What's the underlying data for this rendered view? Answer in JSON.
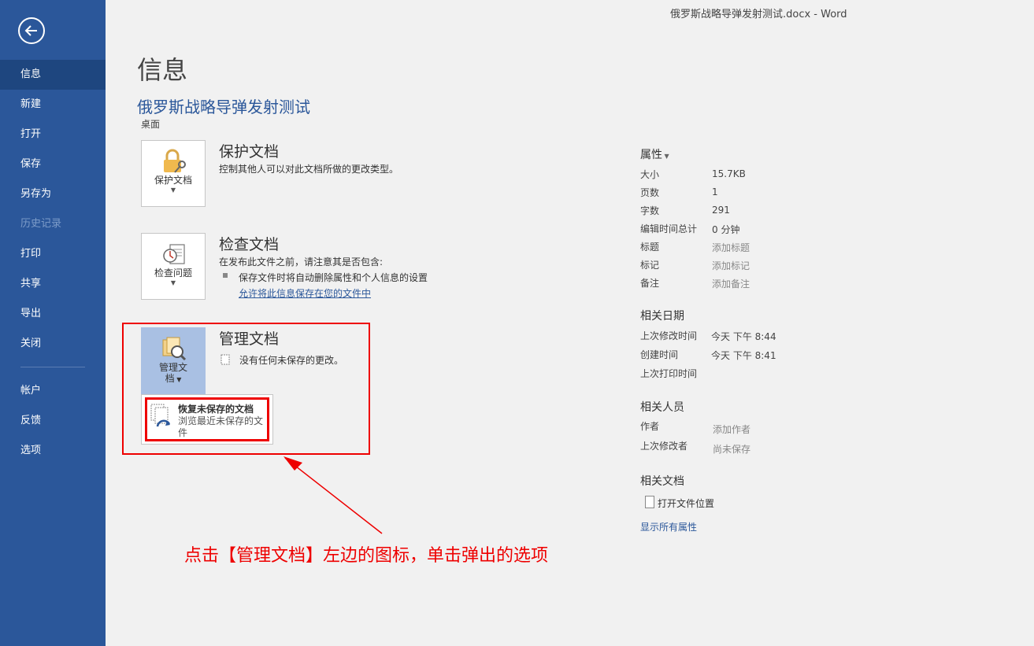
{
  "window_title": "俄罗斯战略导弹发射测试.docx  -  Word",
  "sidebar": {
    "items": [
      {
        "label": "信息",
        "state": "active"
      },
      {
        "label": "新建",
        "state": "normal"
      },
      {
        "label": "打开",
        "state": "normal"
      },
      {
        "label": "保存",
        "state": "normal"
      },
      {
        "label": "另存为",
        "state": "normal"
      },
      {
        "label": "历史记录",
        "state": "disabled"
      },
      {
        "label": "打印",
        "state": "normal"
      },
      {
        "label": "共享",
        "state": "normal"
      },
      {
        "label": "导出",
        "state": "normal"
      },
      {
        "label": "关闭",
        "state": "normal"
      },
      {
        "label": "帐户",
        "state": "normal"
      },
      {
        "label": "反馈",
        "state": "normal"
      },
      {
        "label": "选项",
        "state": "normal"
      }
    ]
  },
  "main": {
    "page_title": "信息",
    "doc_title": "俄罗斯战略导弹发射测试",
    "doc_location": "桌面",
    "protect": {
      "tile_label": "保护文档",
      "title": "保护文档",
      "description": "控制其他人可以对此文档所做的更改类型。"
    },
    "inspect": {
      "tile_label": "检查问题",
      "title": "检查文档",
      "description": "在发布此文件之前，请注意其是否包含:",
      "bullet": "保存文件时将自动删除属性和个人信息的设置",
      "link": "允许将此信息保存在您的文件中"
    },
    "manage": {
      "tile_label_line1": "管理文",
      "tile_label_line2": "档",
      "title": "管理文档",
      "description": "没有任何未保存的更改。"
    },
    "dropdown": {
      "title": "恢复未保存的文档",
      "description": "浏览最近未保存的文件"
    }
  },
  "annotation": "点击【管理文档】左边的图标，单击弹出的选项",
  "properties": {
    "heading": "属性",
    "rows": [
      {
        "key": "大小",
        "value": "15.7KB",
        "placeholder": false
      },
      {
        "key": "页数",
        "value": "1",
        "placeholder": false
      },
      {
        "key": "字数",
        "value": "291",
        "placeholder": false
      },
      {
        "key": "编辑时间总计",
        "value": "0 分钟",
        "placeholder": false
      },
      {
        "key": "标题",
        "value": "添加标题",
        "placeholder": true
      },
      {
        "key": "标记",
        "value": "添加标记",
        "placeholder": true
      },
      {
        "key": "备注",
        "value": "添加备注",
        "placeholder": true
      }
    ],
    "dates_heading": "相关日期",
    "dates": [
      {
        "key": "上次修改时间",
        "value": "今天 下午 8:44"
      },
      {
        "key": "创建时间",
        "value": "今天 下午 8:41"
      },
      {
        "key": "上次打印时间",
        "value": ""
      }
    ],
    "people_heading": "相关人员",
    "people": [
      {
        "key": "作者",
        "value": "添加作者"
      },
      {
        "key": "上次修改者",
        "value": "尚未保存"
      }
    ],
    "docs_heading": "相关文档",
    "open_location": "打开文件位置",
    "show_all": "显示所有属性"
  },
  "colors": {
    "sidebar_bg": "#2b579a",
    "accent": "#2b579a",
    "highlight": "#ee0000"
  }
}
